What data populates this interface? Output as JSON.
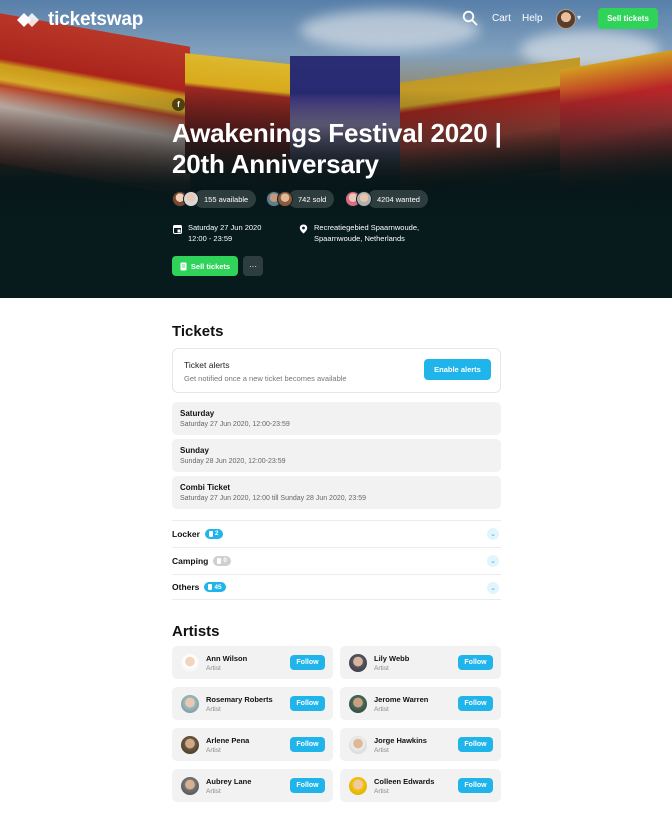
{
  "nav": {
    "brand": "ticketswap",
    "links": {
      "cart": "Cart",
      "help": "Help"
    },
    "sell_label": "Sell tickets"
  },
  "event": {
    "title": "Awakenings Festival 2020 | 20th Anniversary",
    "social_icon": "f",
    "stats": [
      {
        "label": "155 available"
      },
      {
        "label": "742 sold"
      },
      {
        "label": "4204 wanted"
      }
    ],
    "date_line1": "Saturday 27 Jun 2020",
    "date_line2": "12:00 - 23:59",
    "location_line1": "Recreatiegebied Spaarnwoude,",
    "location_line2": "Spaarnwoude, Netherlands",
    "sell_label": "Sell tickets",
    "more_label": "···"
  },
  "tickets": {
    "heading": "Tickets",
    "alert": {
      "title": "Ticket alerts",
      "subtitle": "Get notified once a new ticket becomes available",
      "button": "Enable alerts"
    },
    "days": [
      {
        "title": "Saturday",
        "subtitle": "Saturday 27 Jun 2020, 12:00-23:59"
      },
      {
        "title": "Sunday",
        "subtitle": "Sunday 28 Jun 2020, 12:00-23:59"
      },
      {
        "title": "Combi Ticket",
        "subtitle": "Saturday 27 Jun 2020, 12:00 till Sunday 28 Jun 2020, 23:59"
      }
    ],
    "categories": [
      {
        "label": "Locker",
        "count": "2",
        "color": "#20b5ea"
      },
      {
        "label": "Camping",
        "count": "0",
        "color": "#cfcfcf"
      },
      {
        "label": "Others",
        "count": "45",
        "color": "#20b5ea"
      }
    ]
  },
  "artists": {
    "heading": "Artists",
    "follow_label": "Follow",
    "items": [
      {
        "name": "Ann Wilson",
        "role": "Artist"
      },
      {
        "name": "Lily Webb",
        "role": "Artist"
      },
      {
        "name": "Rosemary Roberts",
        "role": "Artist"
      },
      {
        "name": "Jerome Warren",
        "role": "Artist"
      },
      {
        "name": "Arlene Pena",
        "role": "Artist"
      },
      {
        "name": "Jorge Hawkins",
        "role": "Artist"
      },
      {
        "name": "Aubrey Lane",
        "role": "Artist"
      },
      {
        "name": "Colleen Edwards",
        "role": "Artist"
      }
    ]
  },
  "colors": {
    "green": "#2fd35a",
    "blue": "#20b5ea",
    "hero_dark": "#071a1c"
  }
}
